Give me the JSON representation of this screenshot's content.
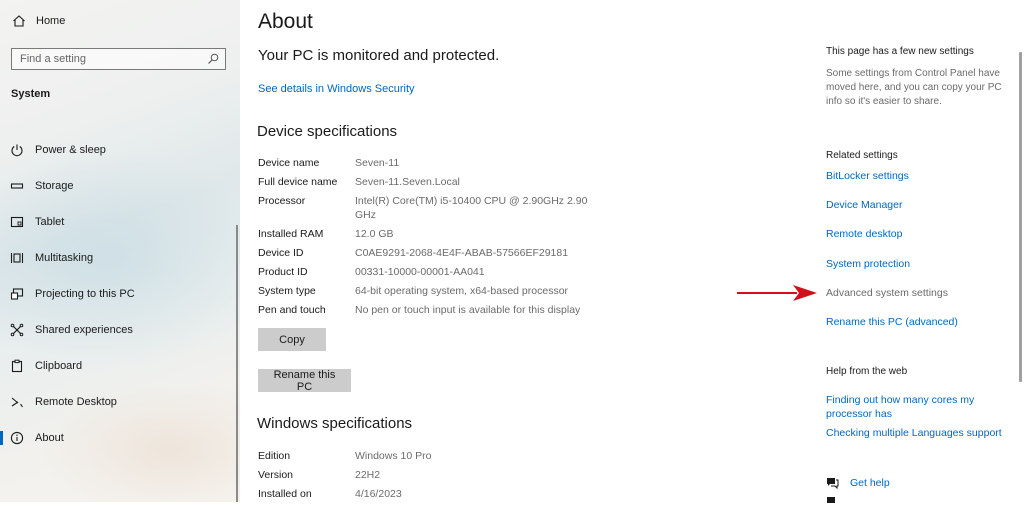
{
  "sidebar": {
    "home_label": "Home",
    "search_placeholder": "Find a setting",
    "section_label": "System",
    "items": [
      {
        "label": "Power & sleep",
        "icon": "power-icon"
      },
      {
        "label": "Storage",
        "icon": "storage-icon"
      },
      {
        "label": "Tablet",
        "icon": "tablet-icon"
      },
      {
        "label": "Multitasking",
        "icon": "multitasking-icon"
      },
      {
        "label": "Projecting to this PC",
        "icon": "projecting-icon"
      },
      {
        "label": "Shared experiences",
        "icon": "shared-experiences-icon"
      },
      {
        "label": "Clipboard",
        "icon": "clipboard-icon"
      },
      {
        "label": "Remote Desktop",
        "icon": "remote-desktop-icon"
      },
      {
        "label": "About",
        "icon": "info-icon",
        "active": true
      }
    ]
  },
  "main": {
    "title": "About",
    "protection_heading": "Your PC is monitored and protected.",
    "security_link": "See details in Windows Security",
    "device_heading": "Device specifications",
    "device_specs": [
      {
        "label": "Device name",
        "value": "Seven-11"
      },
      {
        "label": "Full device name",
        "value": "Seven-11.Seven.Local"
      },
      {
        "label": "Processor",
        "value": "Intel(R) Core(TM) i5-10400 CPU @ 2.90GHz   2.90 GHz"
      },
      {
        "label": "Installed RAM",
        "value": "12.0 GB"
      },
      {
        "label": "Device ID",
        "value": "C0AE9291-2068-4E4F-ABAB-57566EF29181"
      },
      {
        "label": "Product ID",
        "value": "00331-10000-00001-AA041"
      },
      {
        "label": "System type",
        "value": "64-bit operating system, x64-based processor"
      },
      {
        "label": "Pen and touch",
        "value": "No pen or touch input is available for this display"
      }
    ],
    "copy_label": "Copy",
    "rename_label": "Rename this PC",
    "windows_heading": "Windows specifications",
    "windows_specs": [
      {
        "label": "Edition",
        "value": "Windows 10 Pro"
      },
      {
        "label": "Version",
        "value": "22H2"
      },
      {
        "label": "Installed on",
        "value": "4/16/2023"
      }
    ]
  },
  "right": {
    "new_settings_title": "This page has a few new settings",
    "new_settings_desc": "Some settings from Control Panel have moved here, and you can copy your PC info so it's easier to share.",
    "related_heading": "Related settings",
    "related_links": [
      {
        "label": "BitLocker settings",
        "enabled": true
      },
      {
        "label": "Device Manager",
        "enabled": true
      },
      {
        "label": "Remote desktop",
        "enabled": true
      },
      {
        "label": "System protection",
        "enabled": true
      },
      {
        "label": "Advanced system settings",
        "enabled": false
      },
      {
        "label": "Rename this PC (advanced)",
        "enabled": true
      }
    ],
    "help_heading": "Help from the web",
    "help_links": [
      {
        "label": "Finding out how many cores my processor has"
      },
      {
        "label": "Checking multiple Languages support"
      }
    ],
    "get_help_label": "Get help"
  },
  "colors": {
    "accent": "#0067c0",
    "annotation_arrow": "#d0101a"
  }
}
